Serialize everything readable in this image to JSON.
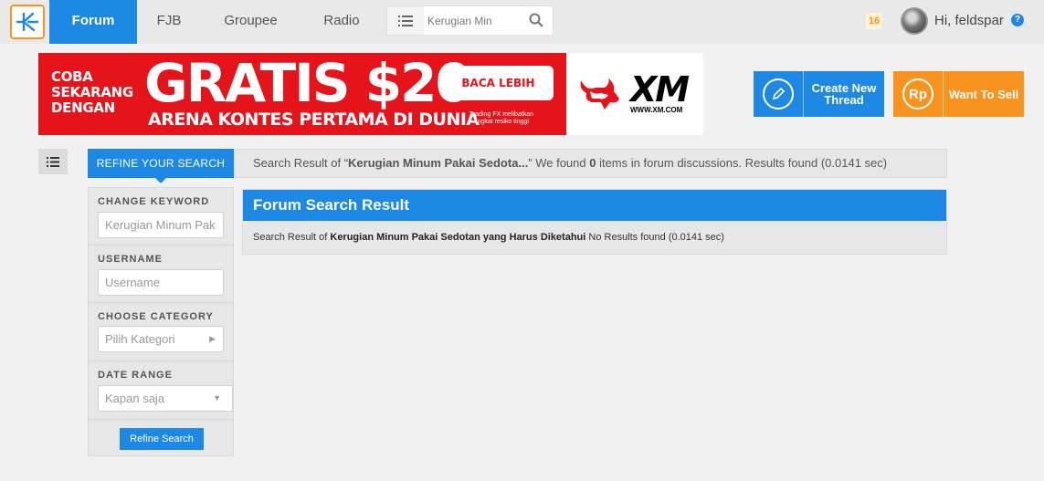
{
  "nav": {
    "items": [
      {
        "label": "Forum",
        "active": true
      },
      {
        "label": "FJB",
        "active": false
      },
      {
        "label": "Groupee",
        "active": false
      },
      {
        "label": "Radio",
        "active": false
      }
    ],
    "search_value": "Kerugian Min",
    "notification_count": "16",
    "greeting": "Hi, feldspar",
    "help_label": "?"
  },
  "banner": {
    "small_text_1": "COBA",
    "small_text_2": "SEKARANG",
    "small_text_3": "DENGAN",
    "headline": "GRATIS $20",
    "subline": "ARENA KONTES PERTAMA DI DUNIA",
    "cta": "BACA LEBIH LANJUT",
    "disclaimer": "Trading FX melibatkan tingkat resiko tinggi",
    "brand": "XM",
    "brand_url": "WWW.XM.COM"
  },
  "actions": {
    "create_label_1": "Create New",
    "create_label_2": "Thread",
    "sell_label": "Want To Sell",
    "sell_icon_text": "Rp"
  },
  "refine": {
    "tab_label": "REFINE YOUR SEARCH",
    "summary_prefix": "Search Result of “",
    "summary_query": "Kerugian Minum Pakai Sedota...",
    "summary_mid": "” We found ",
    "summary_count": "0",
    "summary_suffix": " items in forum discussions. Results found (0.0141 sec)"
  },
  "sidebar": {
    "keyword_label": "CHANGE KEYWORD",
    "keyword_value": "Kerugian Minum Pak",
    "username_label": "USERNAME",
    "username_placeholder": "Username",
    "category_label": "CHOOSE CATEGORY",
    "category_value": "Pilih Kategori",
    "date_label": "DATE RANGE",
    "date_value": "Kapan saja",
    "refine_button": "Refine Search"
  },
  "forum_result": {
    "title": "Forum Search Result",
    "prefix": "Search Result of ",
    "query": "Kerugian Minum Pakai Sedotan yang Harus Diketahui",
    "suffix": " No Results found (0.0141 sec)"
  },
  "colors": {
    "primary": "#1e88e5",
    "accent": "#f7931e",
    "banner_red": "#e5141b"
  }
}
